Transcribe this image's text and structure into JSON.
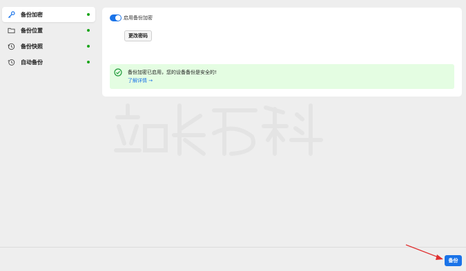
{
  "sidebar": {
    "items": [
      {
        "label": "备份加密",
        "icon": "key-icon",
        "active": true
      },
      {
        "label": "备份位置",
        "icon": "folder-icon",
        "active": false
      },
      {
        "label": "备份快照",
        "icon": "snapshot-icon",
        "active": false
      },
      {
        "label": "自动备份",
        "icon": "clock-icon",
        "active": false
      }
    ],
    "status_color": "#1aa51a"
  },
  "encryption": {
    "toggle_label": "启用备份加密",
    "toggle_on": true,
    "change_password_label": "更改密码"
  },
  "notice": {
    "text": "备份加密已启用，您的设备备份是安全的!",
    "link": "了解详情 →",
    "icon": "check-circle-icon"
  },
  "footer": {
    "backup_label": "备份"
  },
  "colors": {
    "accent": "#1a73e8",
    "success_bg": "#e4fde2",
    "annotation": "#e03030"
  }
}
